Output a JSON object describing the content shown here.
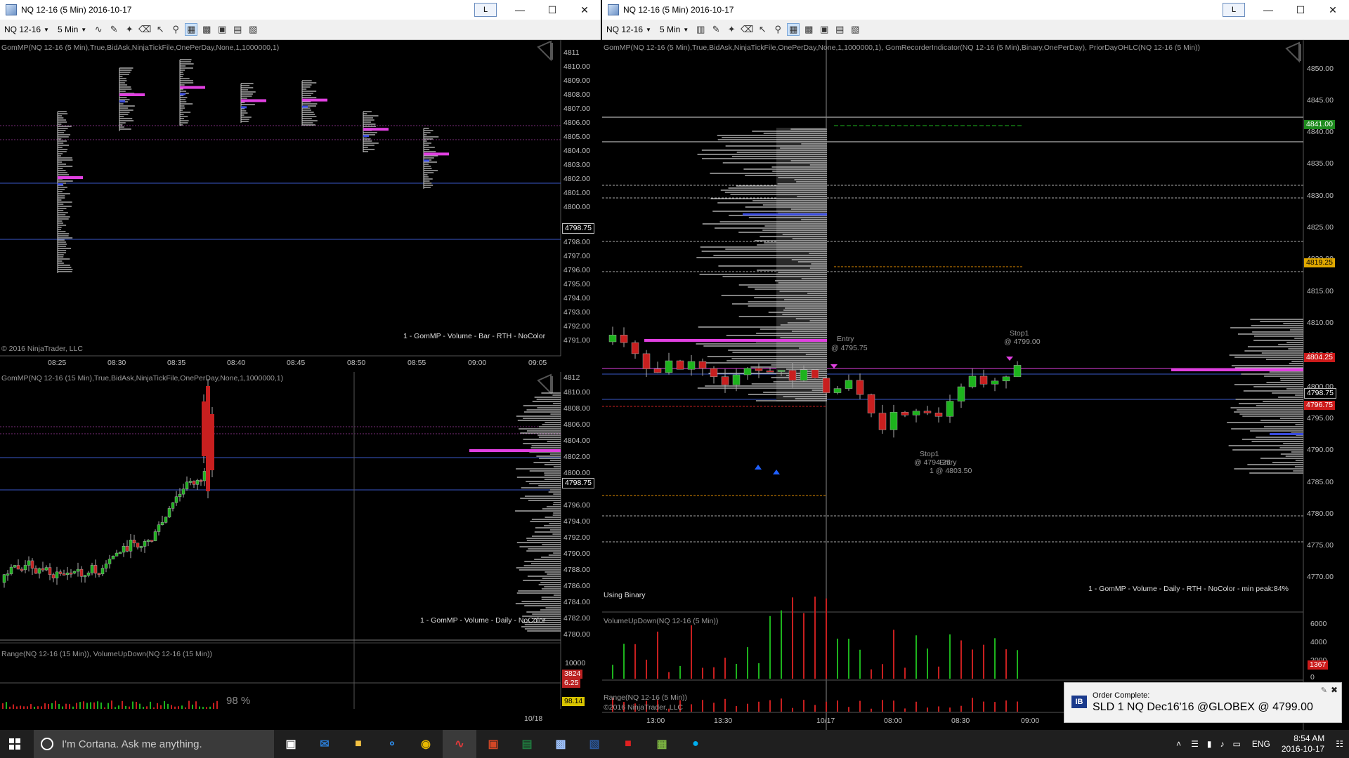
{
  "left_window": {
    "title": "NQ 12-16 (5 Min)  2016-10-17",
    "link_btn": "L",
    "toolbar": {
      "instrument": "NQ 12-16",
      "interval": "5 Min"
    },
    "top_pane": {
      "indicator": "GomMP(NQ 12-16 (5 Min),True,BidAsk,NinjaTickFile,OnePerDay,None,1,1000000,1)",
      "footer": "1 - GomMP  - Volume - Bar - RTH - NoColor",
      "copyright": "© 2016 NinjaTrader, LLC",
      "price_labels": [
        "4811",
        "4810.00",
        "4809.00",
        "4808.00",
        "4807.00",
        "4806.00",
        "4805.00",
        "4804.00",
        "4803.00",
        "4802.00",
        "4801.00",
        "4800.00",
        "4798.75",
        "4798.00",
        "4797.00",
        "4796.00",
        "4795.00",
        "4794.00",
        "4793.00",
        "4792.00",
        "4791.00"
      ],
      "current_price": "4798.75",
      "time_labels": [
        "08:25",
        "08:30",
        "08:35",
        "08:40",
        "08:45",
        "08:50",
        "08:55",
        "09:00",
        "09:05"
      ]
    },
    "bottom_pane": {
      "indicator": "GomMP(NQ 12-16 (15 Min),True,BidAsk,NinjaTickFile,OnePerDay,None,1,1000000,1)",
      "footer": "1 - GomMP  - Volume - Daily - NoColor",
      "price_labels": [
        "4812",
        "4810.00",
        "4808.00",
        "4806.00",
        "4804.00",
        "4802.00",
        "4800.00",
        "4798.75",
        "4796.00",
        "4794.00",
        "4792.00",
        "4790.00",
        "4788.00",
        "4786.00",
        "4784.00",
        "4782.00",
        "4780.00"
      ],
      "current_price": "4798.75",
      "sub_indicator": "Range(NQ 12-16 (15 Min)), VolumeUpDown(NQ 12-16 (15 Min))",
      "sub_value1": "10000",
      "sub_value2": "3824",
      "sub_value3": "6.25",
      "sub_value4": "98.14",
      "percent": "98 %",
      "date_label": "10/18"
    }
  },
  "right_window": {
    "title": "NQ 12-16 (5 Min)  2016-10-17",
    "link_btn": "L",
    "toolbar": {
      "instrument": "NQ 12-16",
      "interval": "5 Min"
    },
    "main_pane": {
      "indicator": "GomMP(NQ 12-16 (5 Min),True,BidAsk,NinjaTickFile,OnePerDay,None,1,1000000,1), GomRecorderIndicator(NQ 12-16 (5 Min),Binary,OnePerDay), PriorDayOHLC(NQ 12-16 (5 Min))",
      "footer": "1 - GomMP  - Volume - Daily - RTH - NoColor - min peak:84%",
      "using": "Using Binary",
      "price_labels": [
        "4850.00",
        "4845.00",
        "4840.00",
        "4835.00",
        "4830.00",
        "4825.00",
        "4820.00",
        "4815.00",
        "4810.00",
        "4805.00",
        "4800.00",
        "4795.00",
        "4790.00",
        "4785.00",
        "4780.00",
        "4775.00",
        "4770.00"
      ],
      "badges": {
        "b1": "4841.00",
        "b2": "4819.25",
        "b3": "4804.25",
        "b4": "4798.75",
        "b5": "4796.75"
      },
      "annotations": {
        "entry1": "Entry",
        "entry1_price": "@ 4795.75",
        "stop1": "Stop1",
        "stop1_price": "@ 4799.00",
        "stop2": "Stop1",
        "stop2_price": "@ 4794.25",
        "entry2": "Entry",
        "entry2_price": "1 @ 4803.50"
      }
    },
    "volume_pane": {
      "indicator": "VolumeUpDown(NQ 12-16 (5 Min))",
      "labels": [
        "6000",
        "4000",
        "2000",
        "0"
      ],
      "badge": "1367"
    },
    "range_pane": {
      "indicator": "Range(NQ 12-16 (5 Min))",
      "copyright": "©2016 NinjaTrader, LLC"
    },
    "time_labels": [
      "13:00",
      "13:30",
      "10/17",
      "08:00",
      "08:30",
      "09:00"
    ]
  },
  "toast": {
    "title": "Order Complete:",
    "message": "SLD 1 NQ Dec16'16 @GLOBEX @ 4799.00",
    "logo": "IB"
  },
  "taskbar": {
    "search": "I'm Cortana. Ask me anything.",
    "time": "8:54 AM",
    "date": "2016-10-17",
    "lang": "ENG"
  }
}
